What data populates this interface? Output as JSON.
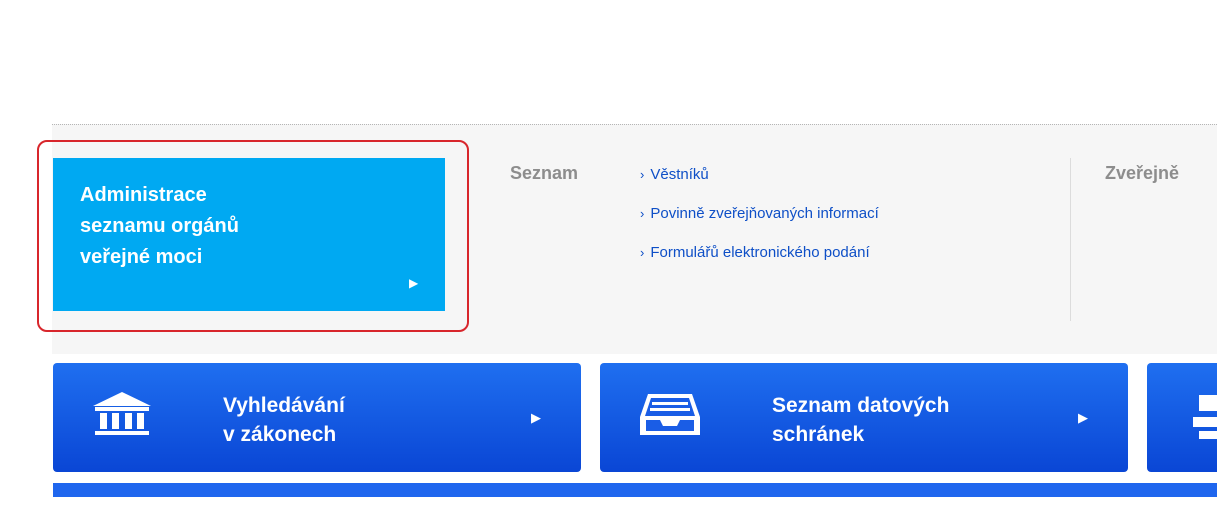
{
  "admin_tile": {
    "label": "Administrace\nseznamu orgánů\nveřejné moci",
    "arrow": "▶"
  },
  "seznam": {
    "label": "Seznam",
    "links": [
      {
        "chevron": "›",
        "text": "Věstníků"
      },
      {
        "chevron": "›",
        "text": "Povinně zveřejňovaných informací"
      },
      {
        "chevron": "›",
        "text": "Formulářů elektronického podání"
      }
    ]
  },
  "zverejne_label": "Zveřejně",
  "buttons": [
    {
      "line1": "Vyhledávání",
      "line2": "v zákonech",
      "icon": "bank-icon",
      "arrow": "▶"
    },
    {
      "line1": "Seznam datových",
      "line2": "schránek",
      "icon": "inbox-tray-icon",
      "arrow": "▶"
    }
  ],
  "colors": {
    "tile_cyan": "#00a9f2",
    "button_blue": "#0a46d5",
    "link_blue": "#0e4fc7",
    "highlight_red": "#d8262c"
  }
}
